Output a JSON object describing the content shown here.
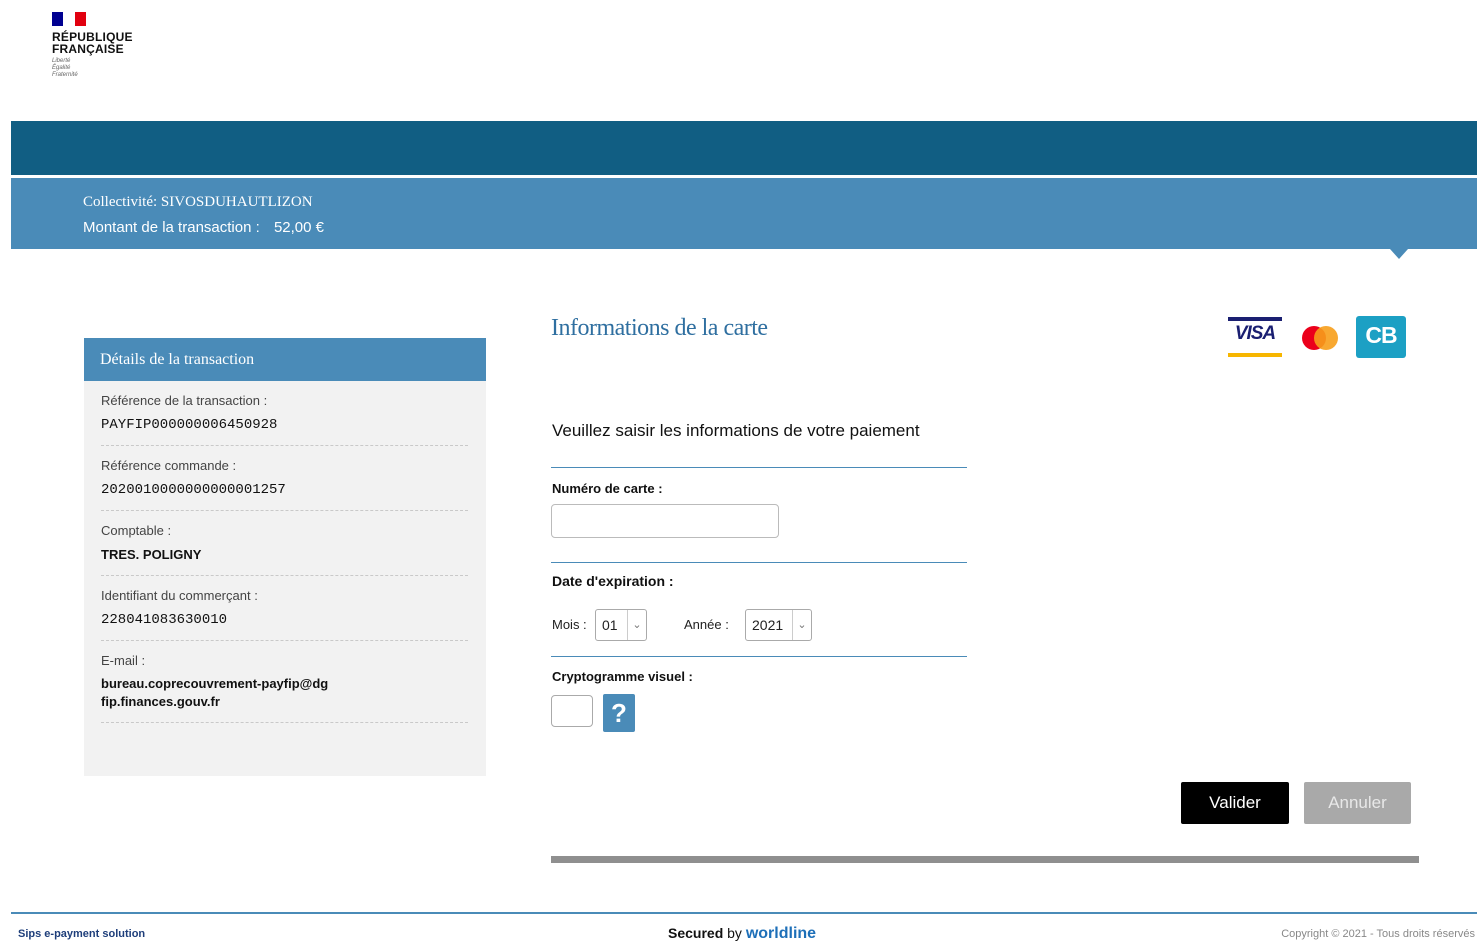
{
  "header": {
    "logo_line1": "RÉPUBLIQUE",
    "logo_line2": "FRANÇAISE",
    "motto": [
      "Liberté",
      "Égalité",
      "Fraternité"
    ]
  },
  "banner": {
    "collectivite_label": "Collectivité:",
    "collectivite_value": "SIVOSDUHAUTLIZON",
    "amount_label": "Montant de la transaction :",
    "amount_value": "52,00 €"
  },
  "details": {
    "title": "Détails de la transaction",
    "items": [
      {
        "label": "Référence de la transaction :",
        "value": "PAYFIP000000006450928"
      },
      {
        "label": "Référence commande :",
        "value": "2020010000000000001257"
      },
      {
        "label": "Comptable :",
        "value": "TRES. POLIGNY"
      },
      {
        "label": "Identifiant du commerçant :",
        "value": "228041083630010"
      },
      {
        "label": "E-mail :",
        "value": "bureau.coprecouvrement-payfip@dgfip.finances.gouv.fr"
      }
    ]
  },
  "form": {
    "title": "Informations de la carte",
    "card_logos": {
      "visa": "VISA",
      "mastercard": "mastercard-logo",
      "cb": "CB"
    },
    "prompt": "Veuillez saisir les informations de votre paiement",
    "card_number_label": "Numéro de carte :",
    "card_number_value": "",
    "expiry_label": "Date d'expiration :",
    "month_label": "Mois :",
    "month_value": "01",
    "year_label": "Année :",
    "year_value": "2021",
    "cvv_label": "Cryptogramme visuel :",
    "cvv_value": "",
    "help_glyph": "?",
    "validate_label": "Valider",
    "cancel_label": "Annuler"
  },
  "footer": {
    "left": "Sips e-payment solution",
    "secured_word": "Secured",
    "by_word": "by",
    "brand": "worldline",
    "right": "Copyright © 2021 - Tous droits réservés"
  },
  "colors": {
    "band_dark": "#115e83",
    "band_light": "#4a8bb8",
    "title_blue": "#2f6fa0"
  }
}
